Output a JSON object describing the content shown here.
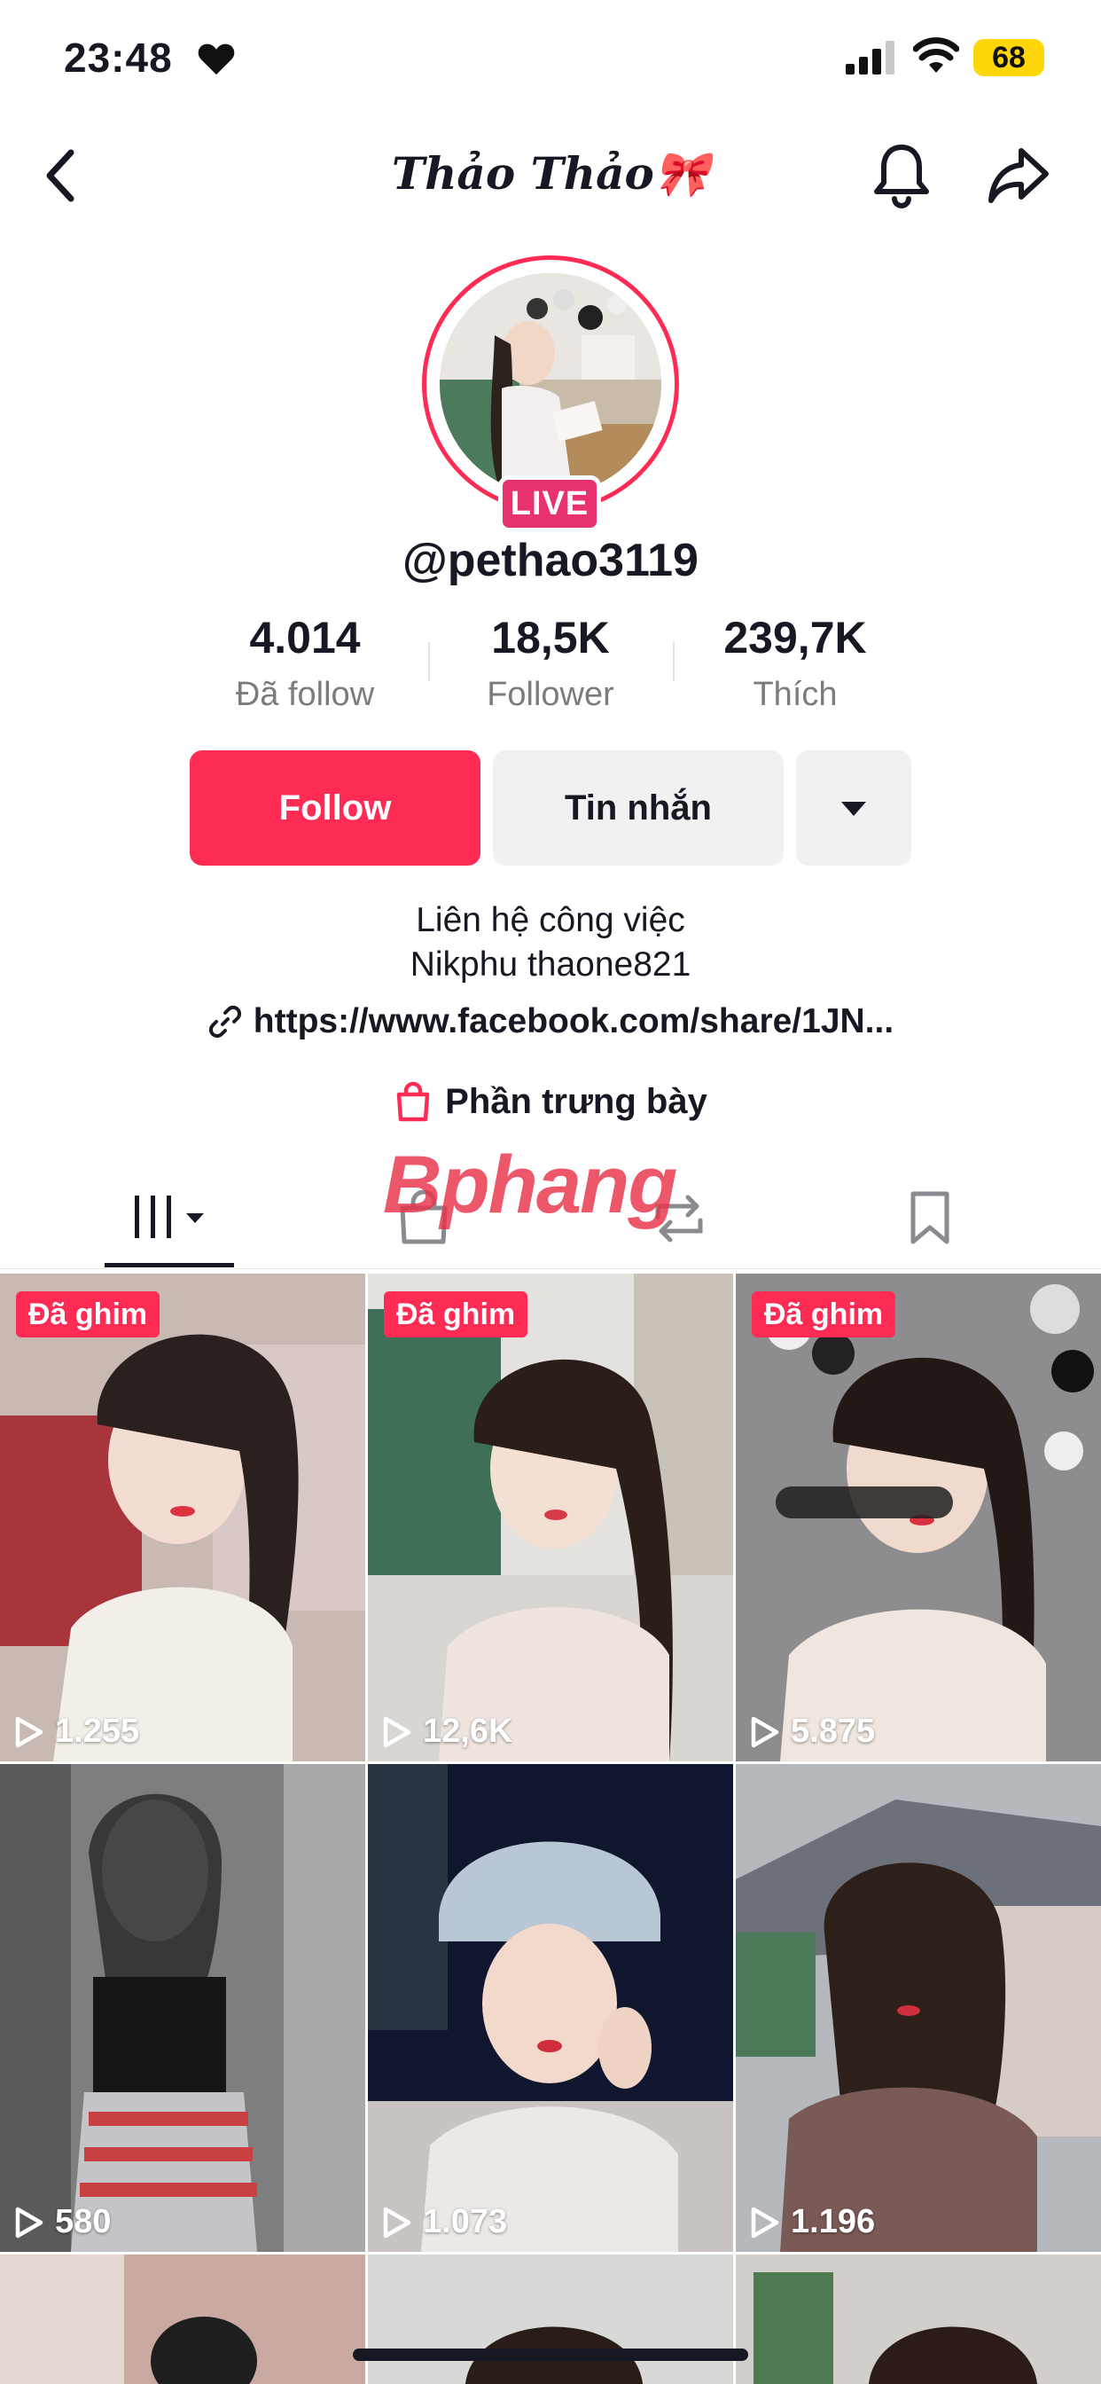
{
  "status_bar": {
    "time": "23:48",
    "battery": "68"
  },
  "header": {
    "title": "Thảo Thảo🎀"
  },
  "profile": {
    "live_label": "LIVE",
    "username": "@pethao3119",
    "stats": [
      {
        "value": "4.014",
        "label": "Đã follow"
      },
      {
        "value": "18,5K",
        "label": "Follower"
      },
      {
        "value": "239,7K",
        "label": "Thích"
      }
    ],
    "follow_label": "Follow",
    "message_label": "Tin nhắn",
    "bio_line1": "Liên hệ công việc",
    "bio_line2": "Nikphu thaone821",
    "link": "https://www.facebook.com/share/1JN...",
    "showcase": "Phần trưng bày"
  },
  "watermark": {
    "part1": "Bphang"
  },
  "videos": [
    {
      "pinned": "Đã ghim",
      "views": "1.255"
    },
    {
      "pinned": "Đã ghim",
      "views": "12,6K"
    },
    {
      "pinned": "Đã ghim",
      "views": "5.875"
    },
    {
      "views": "580"
    },
    {
      "views": "1.073"
    },
    {
      "views": "1.196"
    }
  ],
  "colors": {
    "accent": "#fe2c55",
    "live": "#e8326e",
    "text": "#161823",
    "muted": "#7c7c80"
  }
}
